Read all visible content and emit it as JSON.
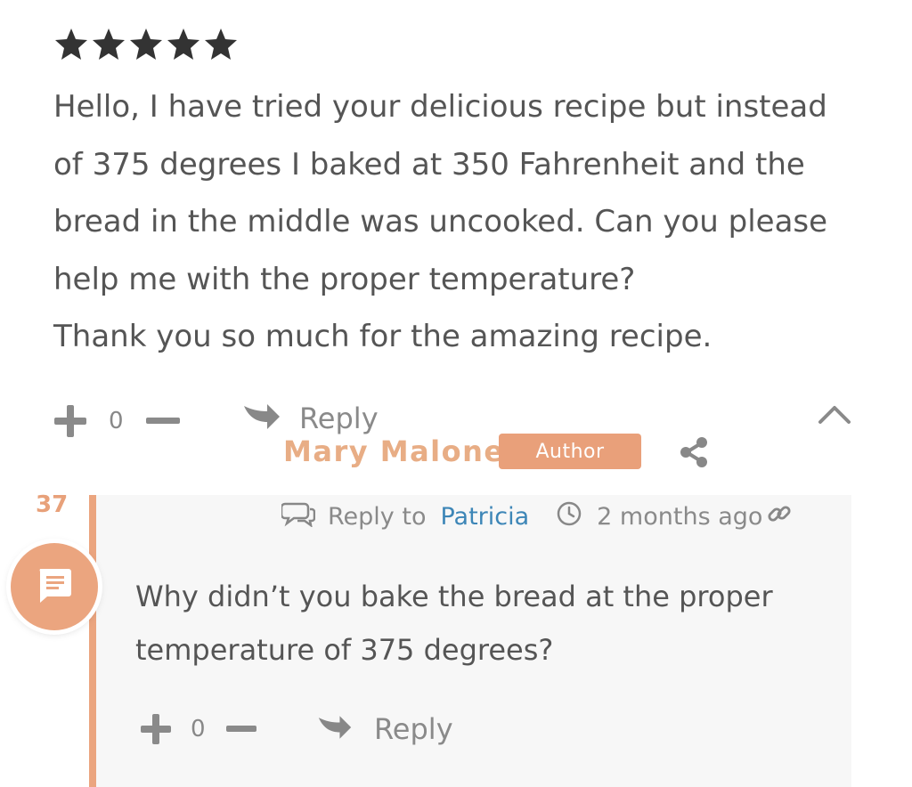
{
  "review": {
    "rating": 5,
    "text": "Hello, I have tried your delicious recipe but instead\nof 375 degrees I baked at 350 Fahrenheit and the\nbread in the middle was uncooked. Can you please\nhelp me with the proper temperature?\nThank you so much for the amazing recipe.",
    "votes": "0",
    "reply_label": "Reply"
  },
  "reply": {
    "author": "Mary Malone",
    "badge": "Author",
    "thread_count": "37",
    "reply_to_label": "Reply to",
    "reply_to_name": "Patricia",
    "time_ago": "2 months ago",
    "text": "Why didn’t you bake the bread at the proper temperature of 375 degrees?",
    "votes": "0",
    "reply_label": "Reply"
  },
  "colors": {
    "accent": "#eba57f",
    "link": "#3d86b7",
    "text": "#555555",
    "muted": "#8a8a8a",
    "star": "#333333"
  },
  "icons": [
    "star-icon",
    "plus-icon",
    "minus-icon",
    "reply-arrow-icon",
    "chevron-up-icon",
    "share-icon",
    "speech-bubble-icon",
    "clock-icon",
    "link-icon",
    "chat-icon"
  ]
}
